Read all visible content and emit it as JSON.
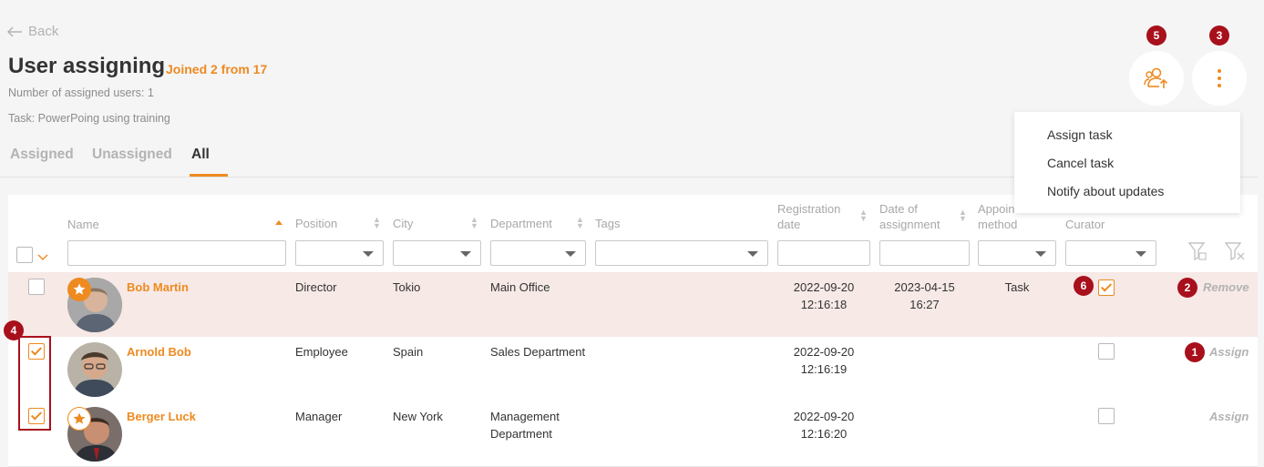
{
  "header": {
    "back_label": "Back",
    "title": "User assigning",
    "joined": "Joined 2 from 17",
    "assigned_count": "Number of assigned users: 1",
    "task": "Task: PowerPoing using training"
  },
  "tabs": [
    {
      "label": "Assigned"
    },
    {
      "label": "Unassigned"
    },
    {
      "label": "All"
    }
  ],
  "menu": {
    "items": [
      "Assign task",
      "Cancel task",
      "Notify about updates"
    ]
  },
  "badges": {
    "b1": "1",
    "b2": "2",
    "b3": "3",
    "b4": "4",
    "b5": "5",
    "b6": "6"
  },
  "columns": {
    "name": "Name",
    "position": "Position",
    "city": "City",
    "department": "Department",
    "tags": "Tags",
    "registration_l1": "Registration",
    "registration_l2": "date",
    "assignment_l1": "Date of",
    "assignment_l2": "assignment",
    "method_l1": "Appoin",
    "method_l2": "method",
    "curator": "Curator"
  },
  "rows": [
    {
      "name": "Bob Martin",
      "position": "Director",
      "city": "Tokio",
      "department_l1": "Main Office",
      "department_l2": "",
      "reg_date": "2022-09-20",
      "reg_time": "12:16:18",
      "assign_date": "2023-04-15",
      "assign_time": "16:27",
      "method": "Task",
      "curator": true,
      "selected": false,
      "action": "Remove"
    },
    {
      "name": "Arnold Bob",
      "position": "Employee",
      "city": "Spain",
      "department_l1": "Sales Department",
      "department_l2": "",
      "reg_date": "2022-09-20",
      "reg_time": "12:16:19",
      "assign_date": "",
      "assign_time": "",
      "method": "",
      "curator": false,
      "selected": true,
      "action": "Assign"
    },
    {
      "name": "Berger Luck",
      "position": "Manager",
      "city": "New York",
      "department_l1": "Management",
      "department_l2": "Department",
      "reg_date": "2022-09-20",
      "reg_time": "12:16:20",
      "assign_date": "",
      "assign_time": "",
      "method": "",
      "curator": false,
      "selected": true,
      "action": "Assign"
    }
  ],
  "colors": {
    "accent": "#ee8a1f",
    "badge": "#a8101c",
    "assigned_row": "#f6e9e6"
  },
  "icons": [
    "arrow-left-icon",
    "users-upload-icon",
    "kebab-menu-icon",
    "star-icon",
    "filter-icon",
    "filter-clear-icon",
    "sort-icon",
    "chevron-down-icon"
  ]
}
